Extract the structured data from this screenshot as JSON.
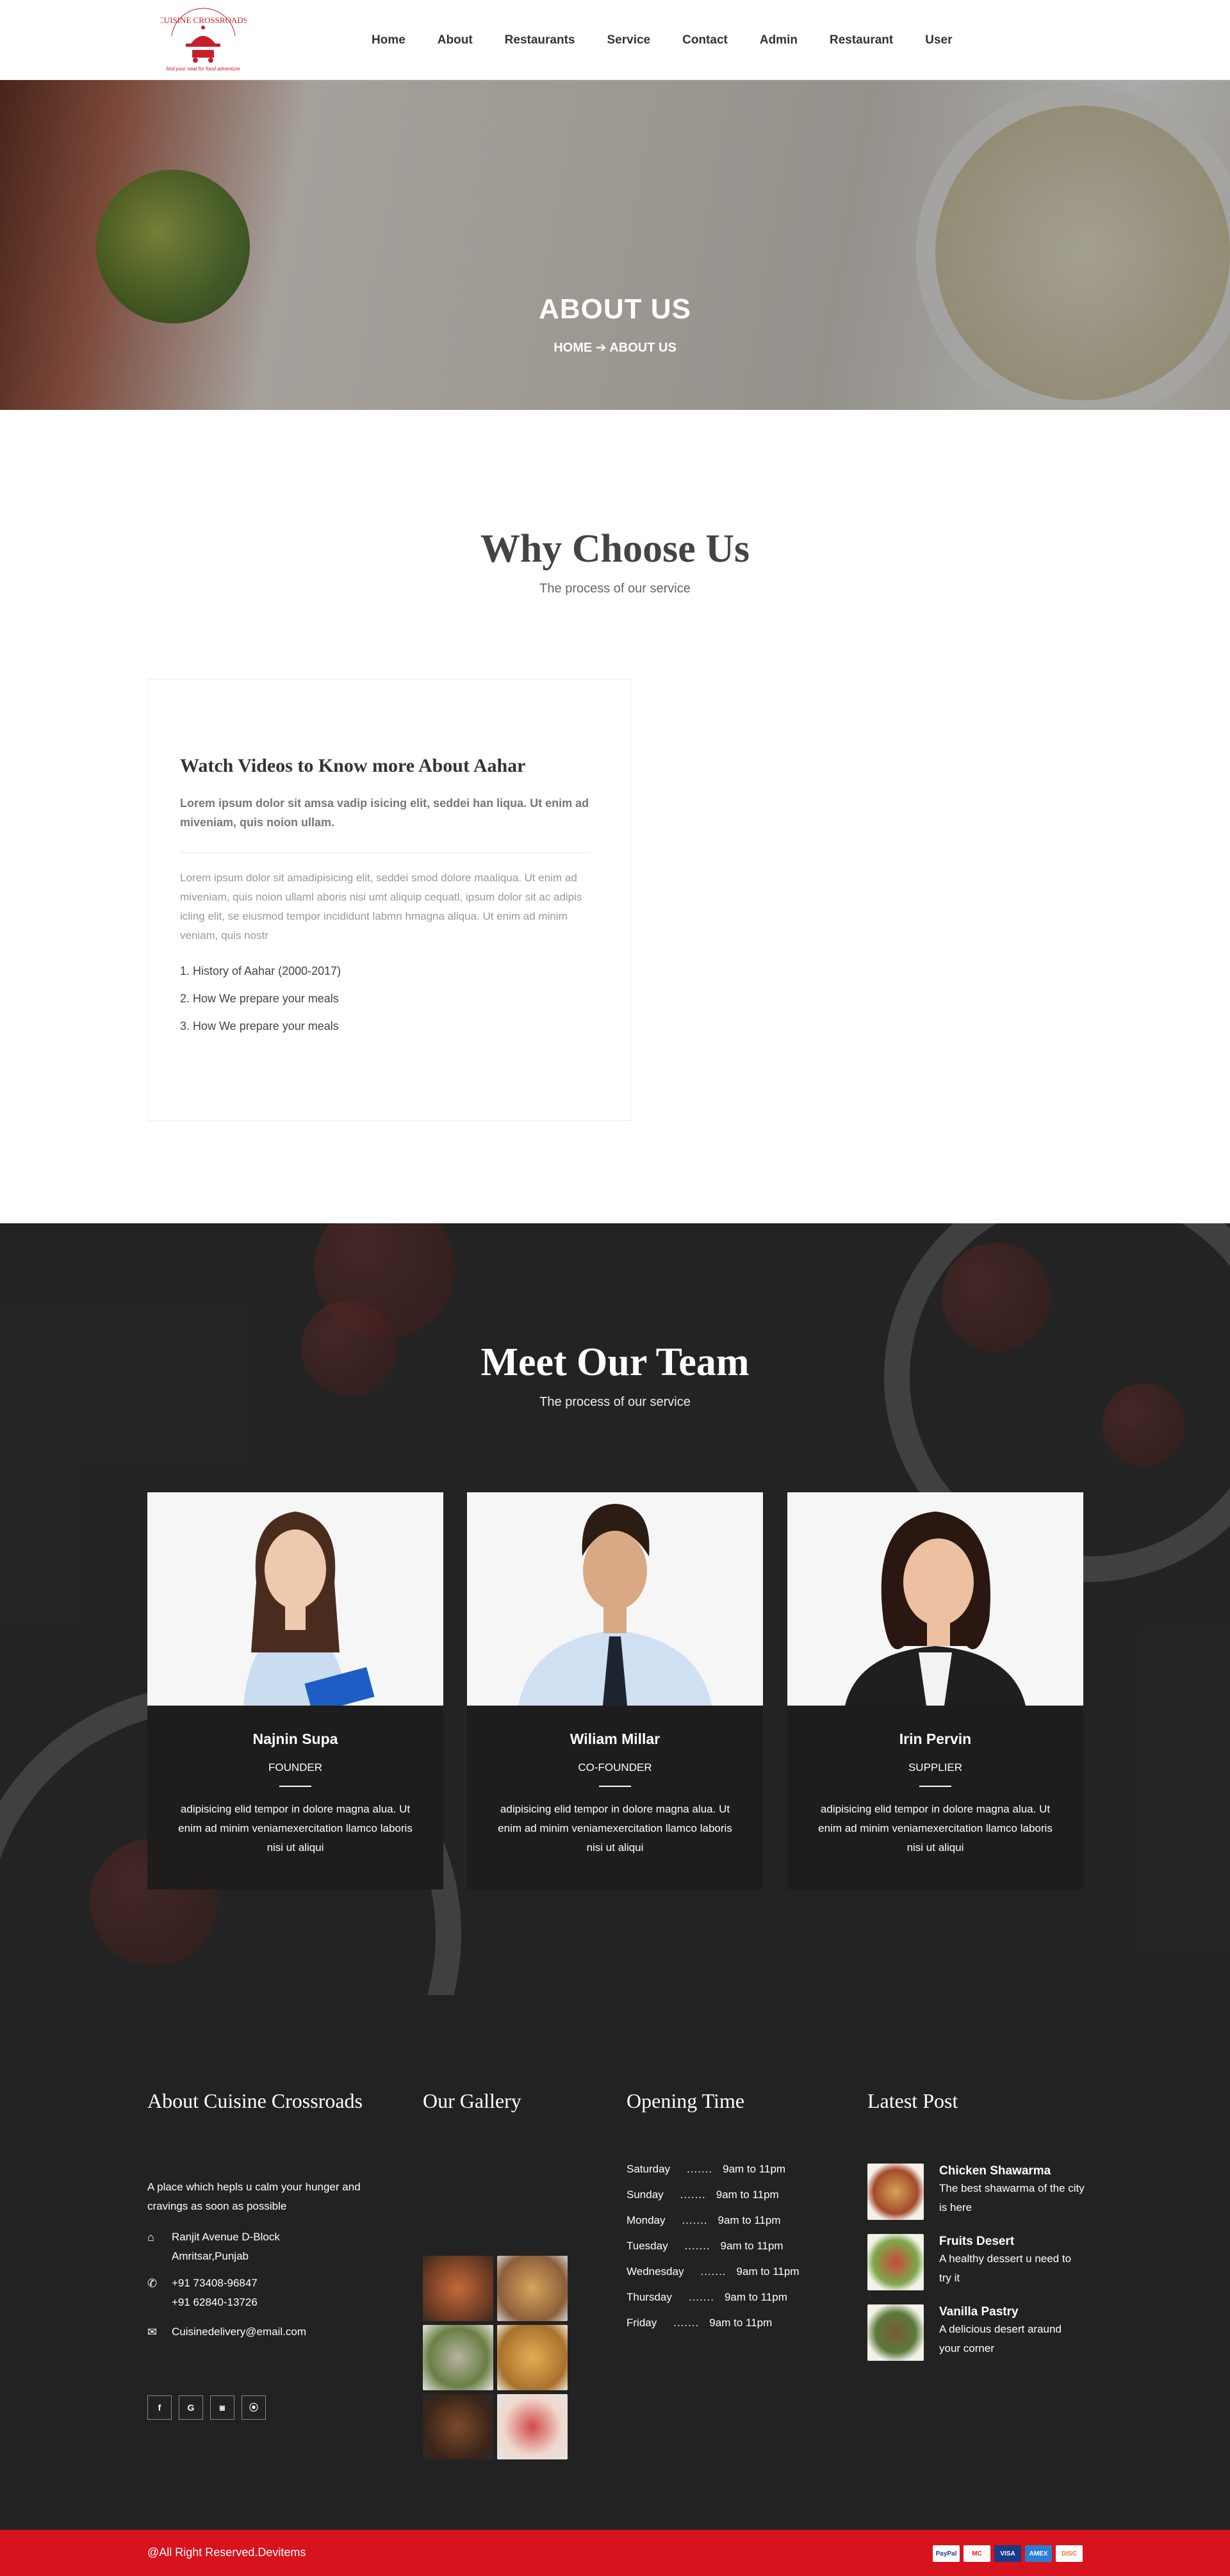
{
  "logo": {
    "name": "Cuisine Crossroads",
    "tagline": "find your seat for food adventure"
  },
  "nav": [
    "Home",
    "About",
    "Restaurants",
    "Service",
    "Contact",
    "Admin",
    "Restaurant",
    "User"
  ],
  "hero": {
    "title": "ABOUT US",
    "crumb_home": "HOME",
    "crumb_sep": "➔",
    "crumb_current": "ABOUT US"
  },
  "why": {
    "title": "Why Choose Us",
    "subtitle": "The process of our service",
    "box_heading": "Watch Videos to Know more About Aahar",
    "lead": "Lorem ipsum dolor sit amsa vadip isicing elit, seddei han liqua. Ut enim ad miveniam, quis noion ullam.",
    "para": "Lorem ipsum dolor sit amadipisicing elit, seddei smod dolore maaliqua. Ut enim ad miveniam, quis noion ullaml aboris nisi umt aliquip cequatl, ipsum dolor sit ac adipis icling elit, se eiusmod tempor incididunt labmn hmagna aliqua. Ut enim ad minim veniam, quis nostr",
    "list": [
      "1. History of Aahar (2000-2017)",
      "2. How We prepare your meals",
      "3. How We prepare your meals"
    ]
  },
  "team": {
    "title": "Meet Our Team",
    "subtitle": "The process of our service",
    "members": [
      {
        "name": "Najnin Supa",
        "role": "FOUNDER",
        "bio": "adipisicing elid tempor in dolore magna alua. Ut enim ad minim veniamexercitation llamco laboris nisi ut aliqui"
      },
      {
        "name": "Wiliam Millar",
        "role": "CO-FOUNDER",
        "bio": "adipisicing elid tempor in dolore magna alua. Ut enim ad minim veniamexercitation llamco laboris nisi ut aliqui"
      },
      {
        "name": "Irin Pervin",
        "role": "SUPPLIER",
        "bio": "adipisicing elid tempor in dolore magna alua. Ut enim ad minim veniamexercitation llamco laboris nisi ut aliqui"
      }
    ]
  },
  "footer": {
    "about_title": "About Cuisine Crossroads",
    "about_text": "A place which hepls u calm your hunger and cravings as soon as possible",
    "address": [
      "Ranjit Avenue D-Block",
      "Amritsar,Punjab"
    ],
    "phones": [
      "+91 73408-96847",
      "+91 62840-13726"
    ],
    "email": "Cuisinedelivery@email.com",
    "social": [
      "f",
      "G",
      "◙",
      "⦿"
    ],
    "gallery_title": "Our Gallery",
    "hours_title": "Opening Time",
    "hours": [
      {
        "day": "Saturday",
        "dots": ".......",
        "time": "9am to 11pm"
      },
      {
        "day": "Sunday",
        "dots": ".......",
        "time": "9am to 11pm"
      },
      {
        "day": "Monday",
        "dots": ".......",
        "time": "9am to 11pm"
      },
      {
        "day": "Tuesday",
        "dots": ".......",
        "time": "9am to 11pm"
      },
      {
        "day": "Wednesday",
        "dots": ".......",
        "time": "9am to 11pm"
      },
      {
        "day": "Thursday",
        "dots": ".......",
        "time": "9am to 11pm"
      },
      {
        "day": "Friday",
        "dots": ".......",
        "time": "9am to 11pm"
      }
    ],
    "posts_title": "Latest Post",
    "posts": [
      {
        "title": "Chicken Shawarma",
        "desc": "The best shawarma of the city is here"
      },
      {
        "title": "Fruits Desert",
        "desc": "A healthy dessert u need to try it"
      },
      {
        "title": "Vanilla Pastry",
        "desc": "A delicious desert araund your corner"
      }
    ],
    "copyright": "@All Right Reserved.Devitems",
    "payments": [
      "PayPal",
      "MC",
      "VISA",
      "AMEX",
      "DISC"
    ]
  },
  "colors": {
    "accent": "#d7131d",
    "footer_bg": "#222222",
    "card_bg": "#1f1c1c"
  }
}
